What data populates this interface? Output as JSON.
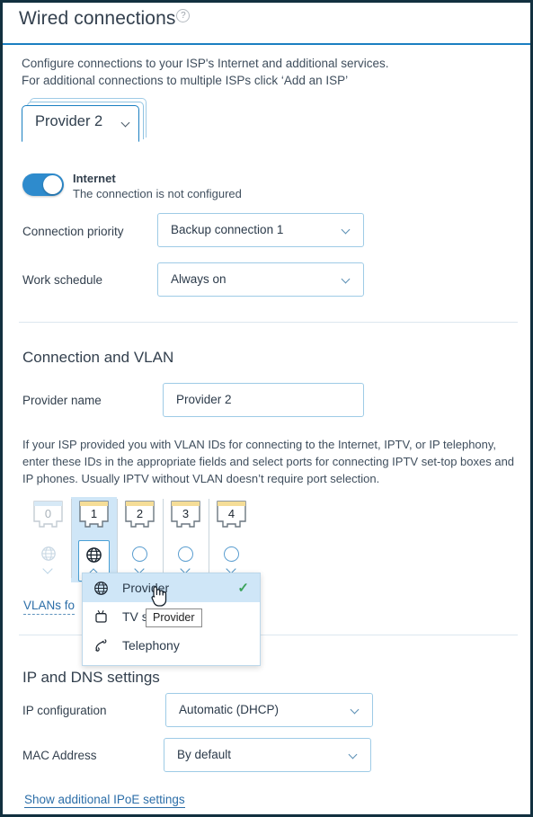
{
  "header": {
    "title": "Wired connections",
    "help_icon": "question-mark-icon"
  },
  "intro": {
    "line1": "Configure connections to your ISP's Internet and additional services.",
    "line2": "For additional connections to multiple ISPs click ‘Add an ISP’"
  },
  "tabs": {
    "active_label": "Provider 2",
    "chevron_icon": "chevron-down-icon"
  },
  "internet": {
    "toggle_state": "on",
    "title": "Internet",
    "status": "The connection is not configured"
  },
  "fields": {
    "connection_priority": {
      "label": "Connection priority",
      "value": "Backup connection 1"
    },
    "work_schedule": {
      "label": "Work schedule",
      "value": "Always on"
    }
  },
  "connection_vlan": {
    "section_title": "Connection and VLAN",
    "provider_name_label": "Provider name",
    "provider_name_value": "Provider 2",
    "description": "If your ISP provided you with VLAN IDs for connecting to the Internet, IPTV, or IP telephony, enter these IDs in the appropriate fields and select ports for connecting IPTV set-top boxes and IP phones. Usually IPTV without VLAN doesn’t require port selection.",
    "vlans_link": "VLANs fo"
  },
  "ports": [
    {
      "number": "0",
      "state": "disabled",
      "icon": "globe-icon",
      "chevron": "chevron-down-icon",
      "top_bar": "#d7e9f6"
    },
    {
      "number": "1",
      "state": "selected",
      "icon": "globe-icon",
      "chevron": "chevron-up-icon",
      "top_bar": "#f5dd97"
    },
    {
      "number": "2",
      "state": "empty",
      "icon": "empty-circle-icon",
      "chevron": "chevron-down-icon",
      "top_bar": "#f5dd97"
    },
    {
      "number": "3",
      "state": "empty",
      "icon": "empty-circle-icon",
      "chevron": "chevron-down-icon",
      "top_bar": "#f5dd97"
    },
    {
      "number": "4",
      "state": "empty",
      "icon": "empty-circle-icon",
      "chevron": "chevron-down-icon",
      "top_bar": "#f5dd97"
    }
  ],
  "port_menu": {
    "items": [
      {
        "label": "Provider",
        "icon": "globe-icon",
        "selected": true
      },
      {
        "label": "TV s",
        "icon": "tv-icon",
        "selected": false
      },
      {
        "label": "Telephony",
        "icon": "phone-icon",
        "selected": false
      }
    ]
  },
  "tooltip": {
    "text": "Provider"
  },
  "ip_dns": {
    "section_title": "IP and DNS settings",
    "ip_configuration": {
      "label": "IP configuration",
      "value": "Automatic (DHCP)"
    },
    "mac_address": {
      "label": "MAC Address",
      "value": "By default"
    },
    "additional_link": "Show additional IPoE settings"
  },
  "colors": {
    "accent_blue": "#1a7fc1",
    "toggle_on": "#2e8bcd",
    "selected_bg": "#cfe6f7",
    "port_top_bar": "#f5dd97",
    "check_green": "#3ba35b",
    "window_border": "#12303f"
  }
}
